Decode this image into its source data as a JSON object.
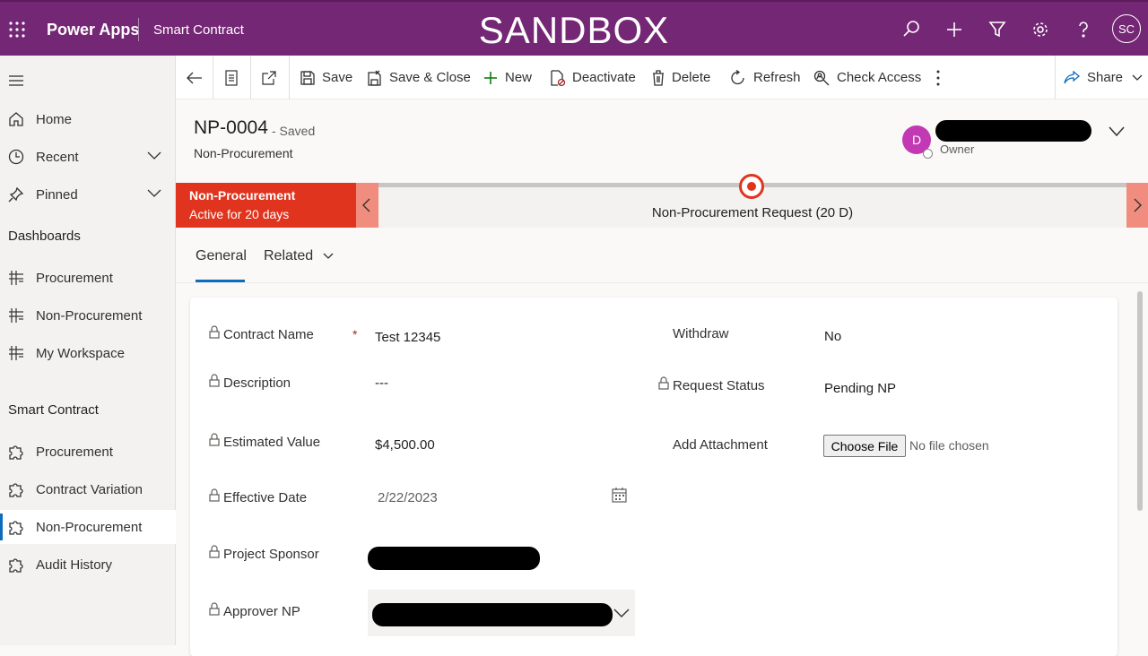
{
  "topbar": {
    "app_name": "Power Apps",
    "module": "Smart Contract",
    "environment": "SANDBOX",
    "user_initials": "SC"
  },
  "sidebar": {
    "items": [
      {
        "label": "Home",
        "icon": "home-icon"
      },
      {
        "label": "Recent",
        "icon": "clock-icon"
      },
      {
        "label": "Pinned",
        "icon": "pin-icon"
      }
    ],
    "group_dashboards": {
      "title": "Dashboards",
      "items": [
        {
          "label": "Procurement",
          "icon": "dashboard-icon"
        },
        {
          "label": "Non-Procurement",
          "icon": "dashboard-icon"
        },
        {
          "label": "My Workspace",
          "icon": "dashboard-icon"
        }
      ]
    },
    "group_smart_contract": {
      "title": "Smart Contract",
      "items": [
        {
          "label": "Procurement",
          "icon": "puzzle-icon"
        },
        {
          "label": "Contract Variation",
          "icon": "puzzle-icon"
        },
        {
          "label": "Non-Procurement",
          "icon": "puzzle-icon",
          "selected": true
        },
        {
          "label": "Audit History",
          "icon": "puzzle-icon"
        }
      ]
    }
  },
  "commands": {
    "save": "Save",
    "save_close": "Save & Close",
    "new": "New",
    "deactivate": "Deactivate",
    "delete": "Delete",
    "refresh": "Refresh",
    "check_access": "Check Access",
    "share": "Share"
  },
  "record": {
    "title": "NP-0004",
    "status": "- Saved",
    "entity": "Non-Procurement",
    "owner_initial": "D",
    "owner_label": "Owner"
  },
  "bpf": {
    "active_stage": "Non-Procurement",
    "active_duration": "Active for 20 days",
    "stage_label": "Non-Procurement Request  (20 D)"
  },
  "tabs": {
    "general": "General",
    "related": "Related"
  },
  "form": {
    "contract_name": {
      "label": "Contract Name",
      "value": "Test 12345",
      "required_mark": "*"
    },
    "description": {
      "label": "Description",
      "value": "---"
    },
    "estimated_value": {
      "label": "Estimated Value",
      "value": "$4,500.00"
    },
    "effective_date": {
      "label": "Effective Date",
      "value": "2/22/2023"
    },
    "project_sponsor": {
      "label": "Project Sponsor"
    },
    "approver_np": {
      "label": "Approver NP"
    },
    "withdraw": {
      "label": "Withdraw",
      "value": "No"
    },
    "request_status": {
      "label": "Request Status",
      "value": "Pending NP"
    },
    "add_attachment": {
      "label": "Add Attachment",
      "button": "Choose File",
      "no_file": "No file chosen"
    }
  },
  "colors": {
    "topbar": "#742774",
    "bpf_active": "#e0341e",
    "accent": "#0f6cbd"
  }
}
